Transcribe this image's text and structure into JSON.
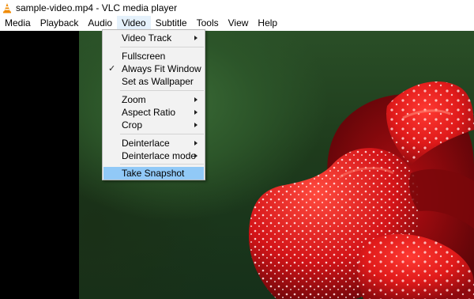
{
  "window": {
    "title": "sample-video.mp4 - VLC media player",
    "icon": "vlc-cone-icon"
  },
  "menubar": {
    "items": [
      "Media",
      "Playback",
      "Audio",
      "Video",
      "Subtitle",
      "Tools",
      "View",
      "Help"
    ],
    "active": "Video"
  },
  "video_menu": {
    "items": [
      {
        "label": "Video Track",
        "submenu": true
      },
      {
        "label": "Fullscreen"
      },
      {
        "label": "Always Fit Window",
        "checked": true
      },
      {
        "label": "Set as Wallpaper"
      },
      {
        "label": "Zoom",
        "submenu": true
      },
      {
        "label": "Aspect Ratio",
        "submenu": true
      },
      {
        "label": "Crop",
        "submenu": true
      },
      {
        "label": "Deinterlace",
        "submenu": true
      },
      {
        "label": "Deinterlace mode",
        "submenu": true
      },
      {
        "label": "Take Snapshot",
        "highlighted": true
      }
    ]
  },
  "colors": {
    "menu_highlight": "#91c9f7",
    "menu_background": "#f2f2f2",
    "video_bg": "#000000"
  }
}
